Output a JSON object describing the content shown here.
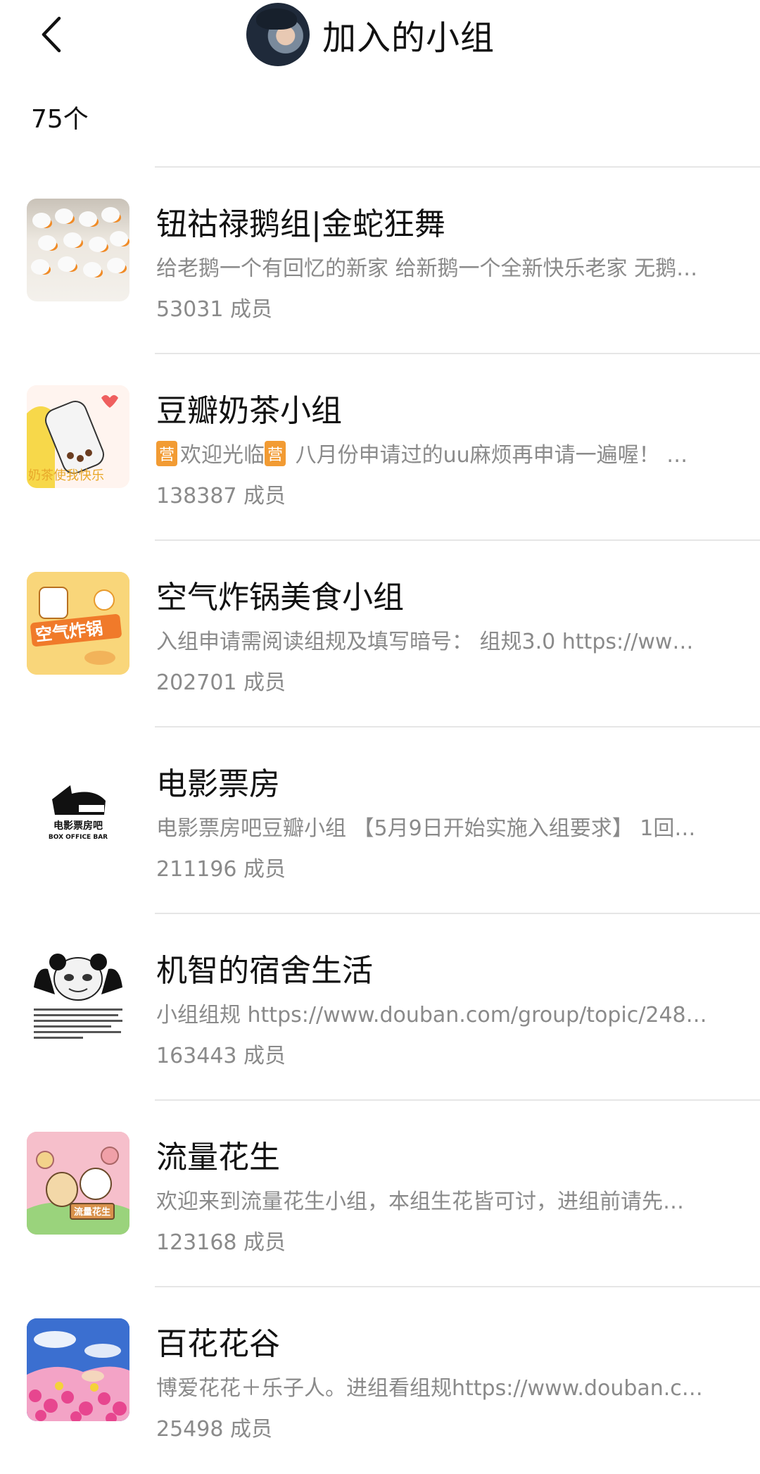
{
  "header": {
    "back_icon": "chevron-left-icon",
    "title": "加入的小组"
  },
  "count_label": "75个",
  "groups": [
    {
      "name": "钮祜禄鹅组|金蛇狂舞",
      "desc": "给老鹅一个有回忆的新家 给新鹅一个全新快乐老家 无鹅…",
      "members": "53031 成员"
    },
    {
      "name": "豆瓣奶茶小组",
      "tag": "营",
      "desc_a": "欢迎光临",
      "desc_b": " 八月份申请过的uu麻烦再申请一遍喔！ …",
      "members": "138387 成员",
      "thumb_text": "奶茶使我快乐"
    },
    {
      "name": "空气炸锅美食小组",
      "desc": "入组申请需阅读组规及填写暗号： 组规3.0 https://ww…",
      "members": "202701 成员",
      "thumb_text": "空气炸锅"
    },
    {
      "name": "电影票房",
      "desc": "电影票房吧豆瓣小组 【5月9日开始实施入组要求】 1回…",
      "members": "211196 成员",
      "thumb_text_1": "电影票房吧",
      "thumb_text_2": "BOX OFFICE BAR"
    },
    {
      "name": "机智的宿舍生活",
      "desc": "小组组规 https://www.douban.com/group/topic/248…",
      "members": "163443 成员"
    },
    {
      "name": "流量花生",
      "desc": "欢迎来到流量花生小组，本组生花皆可讨，进组前请先…",
      "members": "123168 成员",
      "thumb_text": "流量花生"
    },
    {
      "name": "百花花谷",
      "desc": "博爱花花＋乐子人。进组看组规https://www.douban.c…",
      "members": "25498 成员"
    }
  ]
}
